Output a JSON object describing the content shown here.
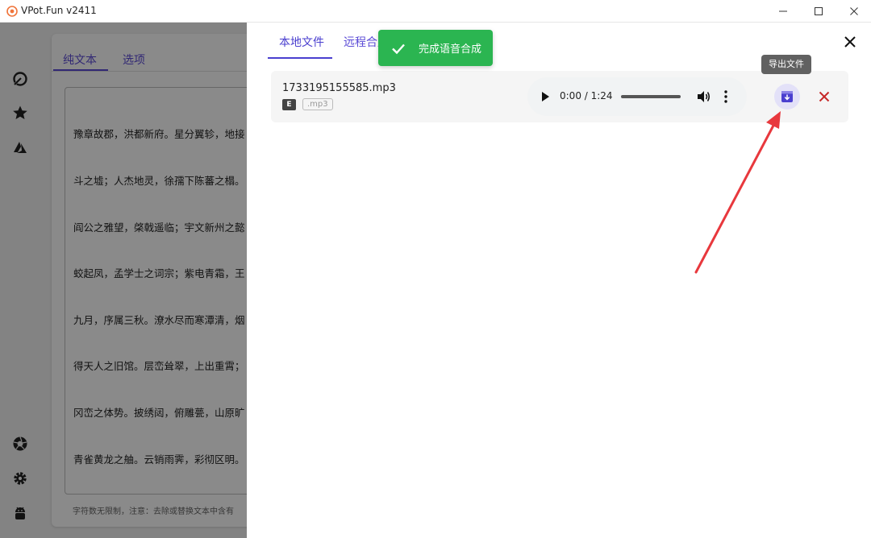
{
  "window": {
    "title": "VPot.Fun v2411",
    "logo_icon": "app-logo-icon",
    "controls": [
      "minimize-icon",
      "maximize-icon",
      "close-icon"
    ]
  },
  "sidebar": {
    "top_icons": [
      "brand-icon",
      "star-icon",
      "azure-icon"
    ],
    "bottom_icons": [
      "aperture-icon",
      "gear-icon",
      "android-icon"
    ]
  },
  "editor": {
    "tabs": [
      {
        "label": "纯文本"
      },
      {
        "label": "选项"
      }
    ],
    "text_lines": [
      "豫章故郡，洪都新府。星分翼轸，地接",
      "斗之墟；人杰地灵，徐孺下陈蕃之榻。",
      "阎公之雅望，棨戟遥临；宇文新州之懿",
      "蛟起凤，孟学士之词宗；紫电青霜，王",
      "九月，序属三秋。潦水尽而寒潭清，烟",
      "得天人之旧馆。层峦耸翠，上出重霄；",
      "冈峦之体势。披绣闼，俯雕甍，山原旷",
      "青雀黄龙之舳。云销雨霁，彩彻区明。"
    ],
    "hint": "字符数无限制，注意：去除或替换文本中含有"
  },
  "drawer": {
    "tabs": [
      {
        "label": "本地文件",
        "active": true
      },
      {
        "label": "远程合成",
        "active": false
      }
    ],
    "close_icon": "close-icon",
    "files": [
      {
        "name": "1733195155585.mp3",
        "badge": "E",
        "ext": ".mp3",
        "player": {
          "time": "0:00 / 1:24",
          "progress": 0
        },
        "export_tooltip": "导出文件"
      }
    ]
  },
  "toast": {
    "message": "完成语音合成",
    "icon": "check-icon",
    "color": "#2bb551"
  },
  "colors": {
    "accent": "#4a3fcf",
    "annotation_arrow": "#e8383d",
    "remove": "#c62828"
  }
}
